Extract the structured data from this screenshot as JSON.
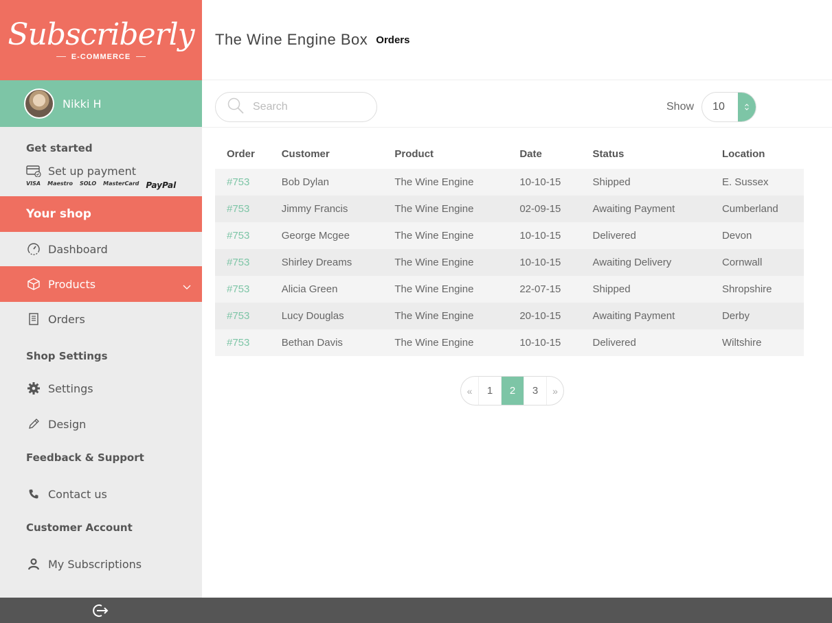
{
  "brand": {
    "name": "Subscriberly",
    "tagline": "E-COMMERCE"
  },
  "user": {
    "name": "Nikki H"
  },
  "sidebar": {
    "get_started": "Get started",
    "setup_payment": "Set up payment",
    "payment_logos": [
      "VISA",
      "Maestro",
      "SOLO",
      "MasterCard",
      "PayPal"
    ],
    "your_shop": "Your shop",
    "dashboard": "Dashboard",
    "products": "Products",
    "orders": "Orders",
    "shop_settings": "Shop Settings",
    "settings": "Settings",
    "design": "Design",
    "feedback_support": "Feedback & Support",
    "contact_us": "Contact us",
    "customer_account": "Customer Account",
    "my_subscriptions": "My Subscriptions"
  },
  "header": {
    "shop_title": "The Wine Engine Box",
    "page_title": "Orders"
  },
  "toolbar": {
    "search_placeholder": "Search",
    "show_label": "Show",
    "show_value": "10"
  },
  "table": {
    "headers": [
      "Order",
      "Customer",
      "Product",
      "Date",
      "Status",
      "Location"
    ],
    "rows": [
      [
        "#753",
        "Bob Dylan",
        "The Wine Engine",
        "10-10-15",
        "Shipped",
        "E. Sussex"
      ],
      [
        "#753",
        "Jimmy Francis",
        "The Wine Engine",
        "02-09-15",
        "Awaiting Payment",
        "Cumberland"
      ],
      [
        "#753",
        "George Mcgee",
        "The Wine Engine",
        "10-10-15",
        "Delivered",
        "Devon"
      ],
      [
        "#753",
        "Shirley Dreams",
        "The Wine Engine",
        "10-10-15",
        "Awaiting Delivery",
        "Cornwall"
      ],
      [
        "#753",
        "Alicia Green",
        "The Wine Engine",
        "22-07-15",
        "Shipped",
        "Shropshire"
      ],
      [
        "#753",
        "Lucy Douglas",
        "The Wine Engine",
        "20-10-15",
        "Awaiting Payment",
        "Derby"
      ],
      [
        "#753",
        "Bethan Davis",
        "The Wine Engine",
        "10-10-15",
        "Delivered",
        "Wiltshire"
      ]
    ]
  },
  "pagination": {
    "prev": "«",
    "pages": [
      "1",
      "2",
      "3"
    ],
    "current": "2",
    "next": "»"
  },
  "colors": {
    "coral": "#ef6f60",
    "mint": "#7dc5a6",
    "footer": "#555555"
  }
}
